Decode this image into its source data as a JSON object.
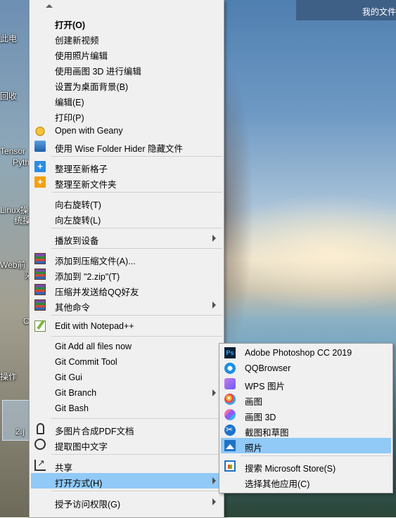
{
  "desktop": {
    "icon_labels": [
      "此电",
      "回收",
      "Tensor",
      "Pyth",
      "Linux操",
      "统操",
      "Web前",
      "采",
      "C",
      "操作",
      "2.j"
    ],
    "window_title": "我的文件"
  },
  "context_menu": {
    "items": [
      {
        "label": "打开(O)",
        "icon": ""
      },
      {
        "label": "创建新视频",
        "icon": ""
      },
      {
        "label": "使用照片编辑",
        "icon": ""
      },
      {
        "label": "使用画图 3D 进行编辑",
        "icon": ""
      },
      {
        "label": "设置为桌面背景(B)",
        "icon": ""
      },
      {
        "label": "编辑(E)",
        "icon": ""
      },
      {
        "label": "打印(P)",
        "icon": ""
      },
      {
        "label": "Open with Geany",
        "icon": "geany-icon"
      },
      {
        "label": "使用 Wise Folder Hider 隐藏文件",
        "icon": "wise-folder-hider-icon"
      },
      {
        "label": "整理至新格子",
        "icon": "plus-box-icon"
      },
      {
        "label": "整理至新文件夹",
        "icon": "plus-box-orange-icon"
      },
      {
        "label": "向右旋转(T)",
        "icon": ""
      },
      {
        "label": "向左旋转(L)",
        "icon": ""
      },
      {
        "label": "播放到设备",
        "icon": ""
      },
      {
        "label": "添加到压缩文件(A)...",
        "icon": "winrar-icon"
      },
      {
        "label": "添加到 \"2.zip\"(T)",
        "icon": "winrar-icon"
      },
      {
        "label": "压缩并发送给QQ好友",
        "icon": "winrar-icon"
      },
      {
        "label": "其他命令",
        "icon": "winrar-icon"
      },
      {
        "label": "Edit with Notepad++",
        "icon": "notepad-plus-plus-icon"
      },
      {
        "label": "Git Add all files now",
        "icon": ""
      },
      {
        "label": "Git Commit Tool",
        "icon": ""
      },
      {
        "label": "Git Gui",
        "icon": ""
      },
      {
        "label": "Git Branch",
        "icon": ""
      },
      {
        "label": "Git Bash",
        "icon": ""
      },
      {
        "label": "多图片合成PDF文档",
        "icon": "pdf-merge-icon"
      },
      {
        "label": "提取图中文字",
        "icon": "ocr-icon"
      },
      {
        "label": "共享",
        "icon": "share-icon"
      },
      {
        "label": "打开方式(H)",
        "icon": ""
      },
      {
        "label": "授予访问权限(G)",
        "icon": ""
      }
    ]
  },
  "open_with_submenu": {
    "items": [
      {
        "label": "Adobe Photoshop CC 2019",
        "icon": "photoshop-icon"
      },
      {
        "label": "QQBrowser",
        "icon": "qqbrowser-icon"
      },
      {
        "label": "WPS 图片",
        "icon": "wps-image-icon"
      },
      {
        "label": "画图",
        "icon": "paint-icon"
      },
      {
        "label": "画图 3D",
        "icon": "paint-3d-icon"
      },
      {
        "label": "截图和草图",
        "icon": "snip-sketch-icon"
      },
      {
        "label": "照片",
        "icon": "photos-icon"
      },
      {
        "label": "搜索 Microsoft Store(S)",
        "icon": "microsoft-store-icon"
      },
      {
        "label": "选择其他应用(C)",
        "icon": ""
      }
    ]
  },
  "colors": {
    "menu_background": "#f0f0f0",
    "highlight": "#91c9f7",
    "separator": "#d0d0d0"
  }
}
